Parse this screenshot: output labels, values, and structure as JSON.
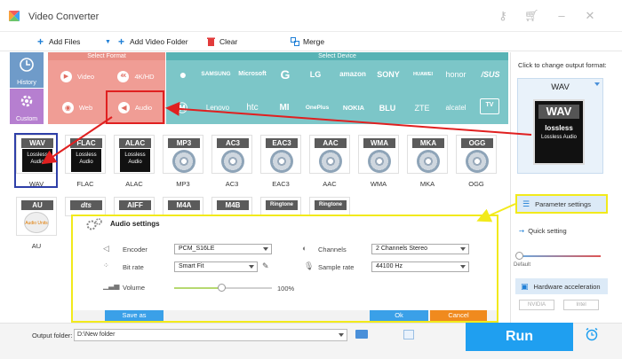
{
  "app": {
    "title": "Video Converter"
  },
  "toolbar": {
    "add_files": "Add Files",
    "add_folder": "Add Video Folder",
    "clear": "Clear",
    "merge": "Merge"
  },
  "leftnav": {
    "history": "History",
    "custom": "Custom"
  },
  "format_section": {
    "header": "Select Format",
    "items": [
      "Video",
      "4K/HD",
      "Web",
      "Audio"
    ]
  },
  "device_section": {
    "header": "Select Device",
    "brands_row1": [
      "SAMSUNG",
      "Microsoft",
      "G",
      "LG",
      "amazon",
      "SONY",
      "HUAWEI",
      "honor",
      "/SUS"
    ],
    "brands_row2": [
      "Lenovo",
      "htc",
      "MI",
      "OnePlus",
      "NOKIA",
      "BLU",
      "ZTE",
      "alcatel",
      "TV"
    ]
  },
  "formats_row1": [
    "WAV",
    "FLAC",
    "ALAC",
    "MP3",
    "AC3",
    "EAC3",
    "AAC",
    "WMA",
    "MKA",
    "OGG"
  ],
  "formats_row2": [
    "AU",
    "DTS",
    "AIFF",
    "M4A",
    "M4B",
    "Ringtone",
    "Ringtone"
  ],
  "format_tags": {
    "lossless_line1": "Lossless",
    "lossless_line2": "Audio",
    "au_sub": "Audio Units"
  },
  "right_panel": {
    "hint": "Click to change output format:",
    "output_format": "WAV",
    "logo_tag": "WAV",
    "logo_text1": "lossless",
    "logo_text2": "Lossless Audio",
    "param_settings": "Parameter settings",
    "quick_setting": "Quick setting",
    "slider_default": "Default",
    "hw_accel": "Hardware acceleration",
    "gpu1": "NVIDIA",
    "gpu2": "Intel"
  },
  "dialog": {
    "title": "Audio settings",
    "encoder_label": "Encoder",
    "encoder_value": "PCM_S16LE",
    "bitrate_label": "Bit rate",
    "bitrate_value": "Smart Fit",
    "volume_label": "Volume",
    "volume_value": "100%",
    "channels_label": "Channels",
    "channels_value": "2 Channels Stereo",
    "sample_rate_label": "Sample rate",
    "sample_rate_value": "44100 Hz",
    "save_as": "Save as",
    "ok": "Ok",
    "cancel": "Cancel"
  },
  "bottom": {
    "output_folder_label": "Output folder:",
    "output_folder_value": "D:\\New folder",
    "run": "Run"
  },
  "colors": {
    "format_header": "#e98f86",
    "format_area": "#f09d95",
    "device_area": "#7cc6c8",
    "run_button": "#1f9ff0",
    "highlight_yellow": "#f2ea1b",
    "arrow_red": "#e02020"
  }
}
